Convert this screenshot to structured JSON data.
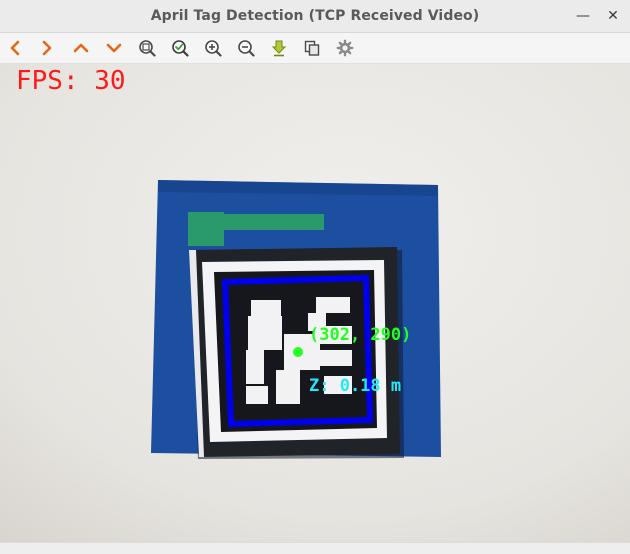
{
  "window": {
    "title": "April Tag Detection (TCP Received Video)",
    "minimize_glyph": "—",
    "close_glyph": "✕"
  },
  "toolbar": {
    "buttons": [
      {
        "name": "back-arrow-icon",
        "color": "#e8651a"
      },
      {
        "name": "forward-arrow-icon",
        "color": "#e8651a"
      },
      {
        "name": "up-arrow-icon",
        "color": "#e8651a"
      },
      {
        "name": "down-arrow-icon",
        "color": "#e8651a"
      },
      {
        "name": "zoom-fit-icon",
        "color": "#4a4a4a"
      },
      {
        "name": "zoom-original-icon",
        "color": "#3a8a3a"
      },
      {
        "name": "zoom-in-icon",
        "color": "#4a4a4a"
      },
      {
        "name": "zoom-out-icon",
        "color": "#4a4a4a"
      },
      {
        "name": "save-download-icon",
        "color": "#8aa020"
      },
      {
        "name": "copy-icon",
        "color": "#4a4a4a"
      },
      {
        "name": "settings-gear-icon",
        "color": "#8a8a8a"
      }
    ]
  },
  "overlay": {
    "fps_label": "FPS: 30",
    "center_label": "(302, 290)",
    "z_label": "Z: 0.18 m",
    "fps_color": "#ff1a1a",
    "center_color": "#22ff22",
    "z_color": "#22e8ff",
    "box_color": "#0000ee"
  }
}
